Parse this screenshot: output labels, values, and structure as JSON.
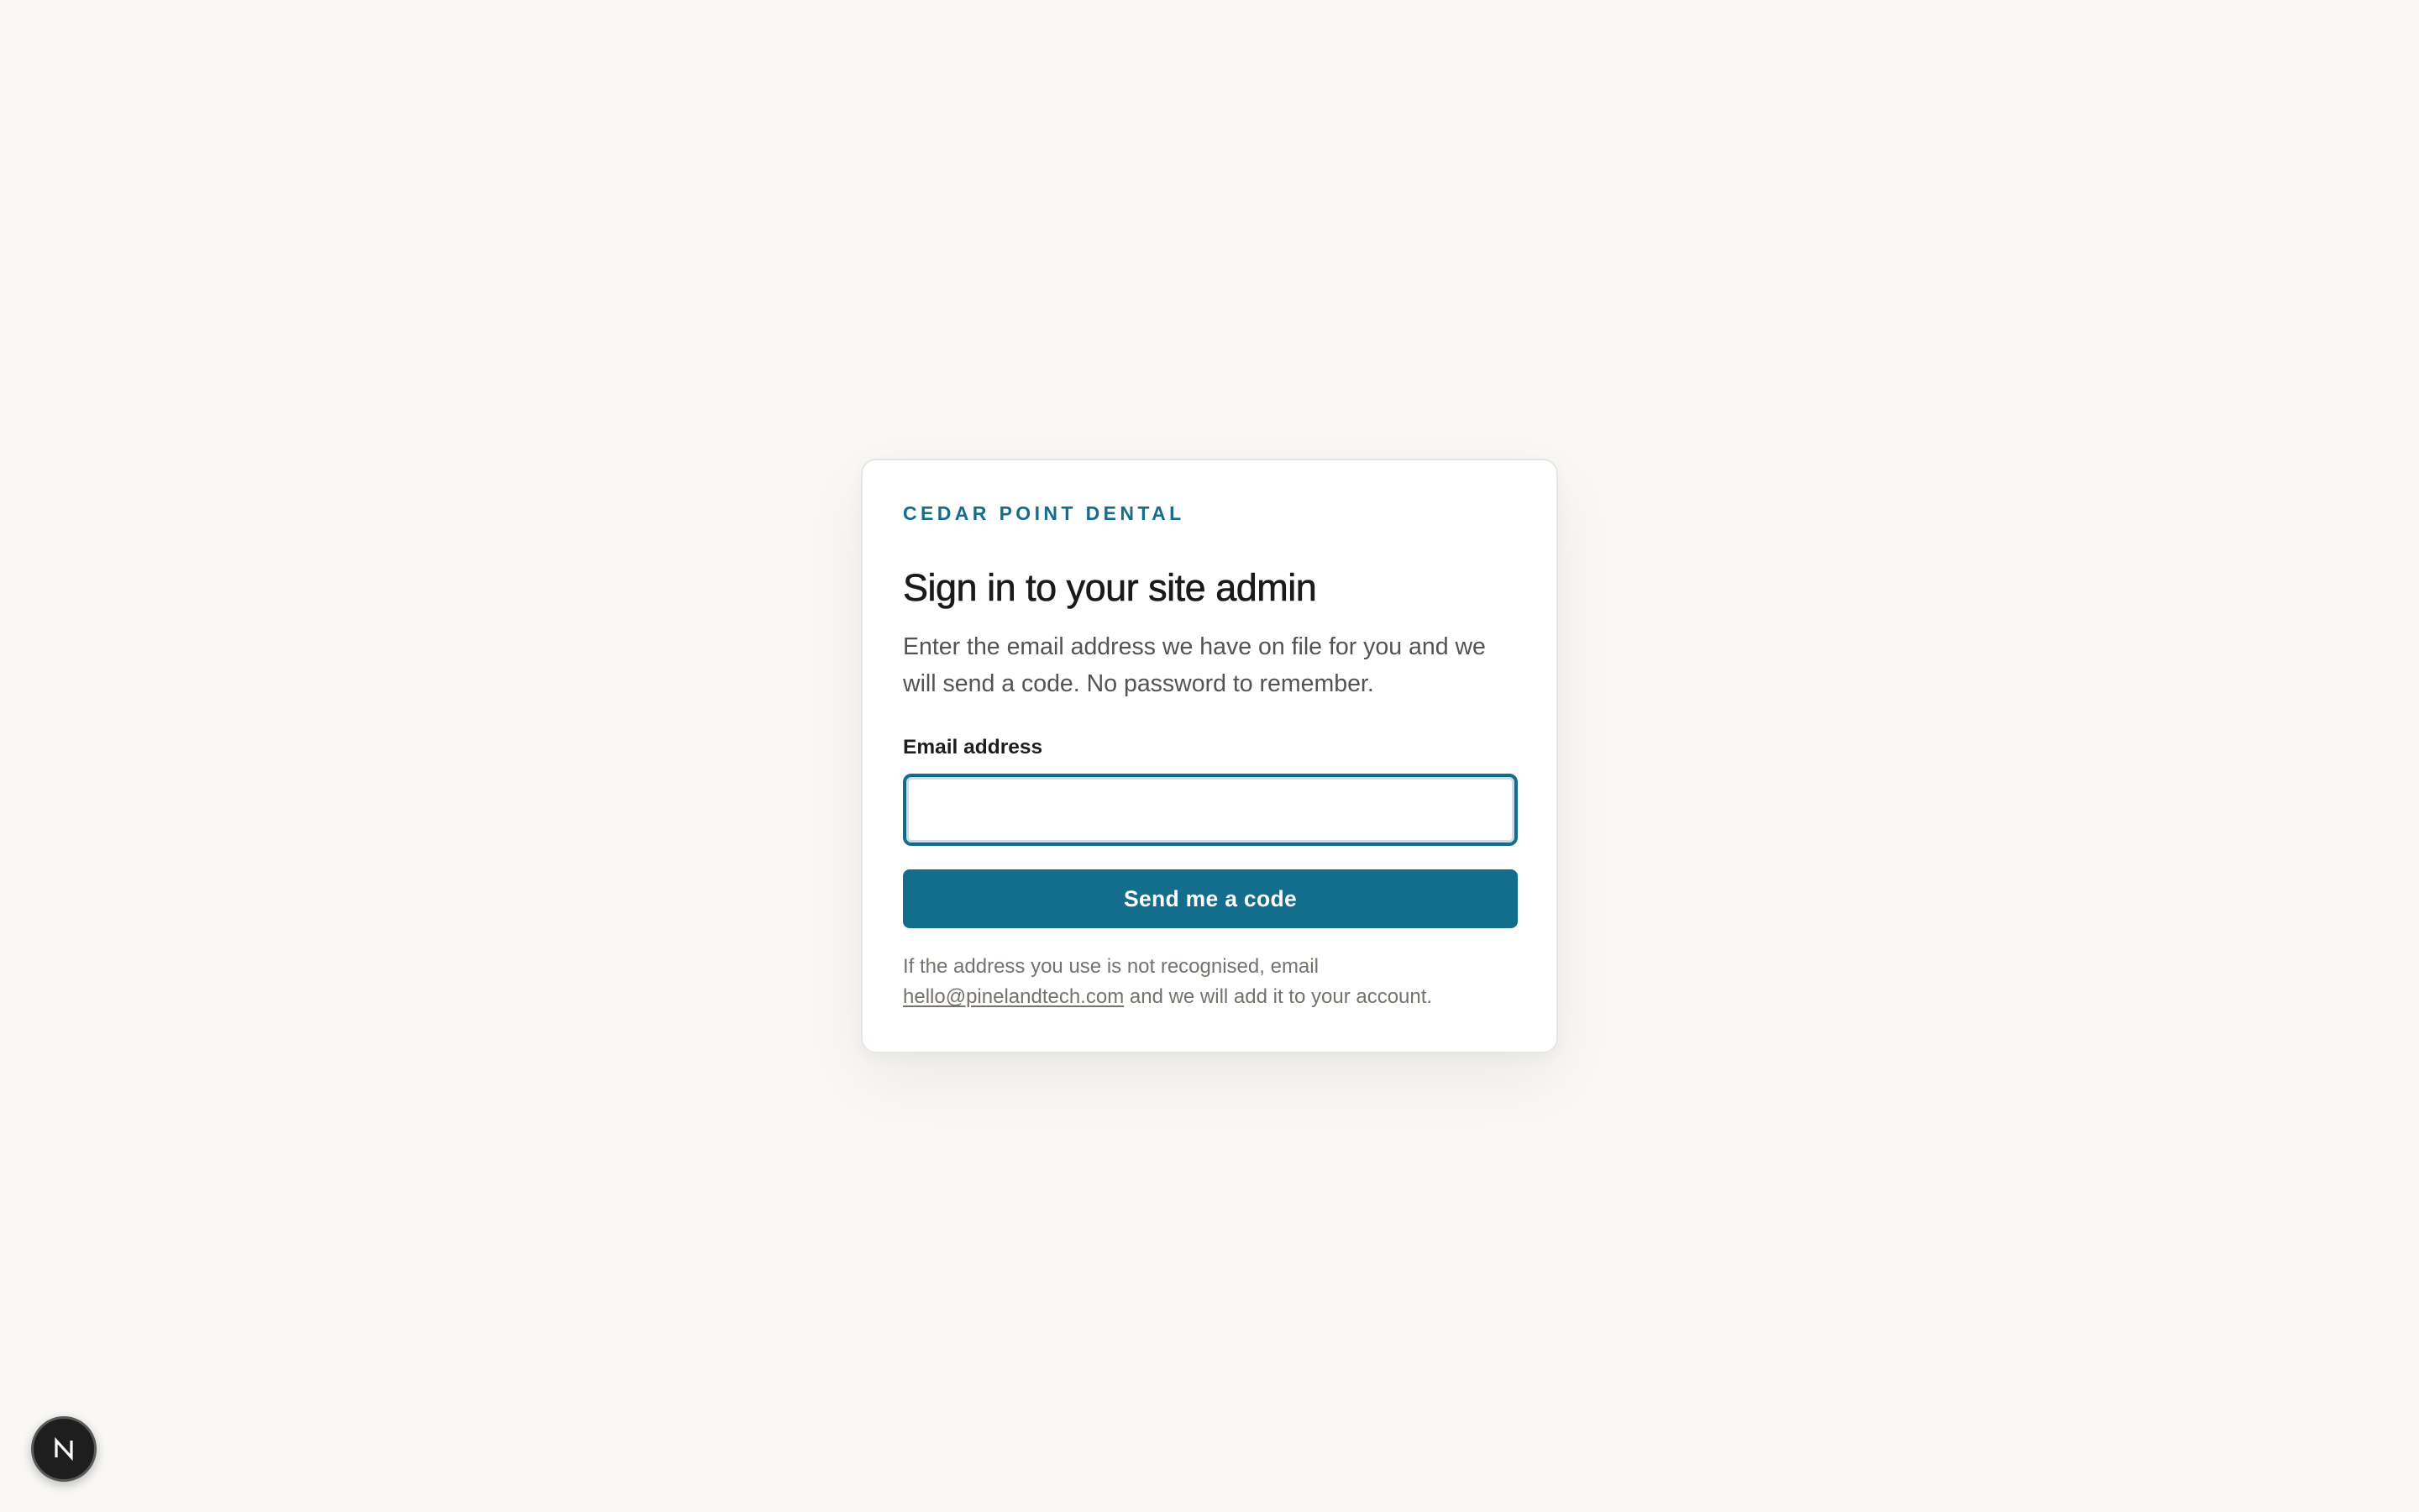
{
  "login": {
    "brand": "CEDAR POINT DENTAL",
    "title": "Sign in to your site admin",
    "subtitle": "Enter the email address we have on file for you and we will send a code. No password to remember.",
    "email_label": "Email address",
    "email_value": "",
    "email_placeholder": "",
    "submit_label": "Send me a code",
    "help_prefix": "If the address you use is not recognised, email",
    "help_email": "hello@pinelandtech.com",
    "help_suffix": "and we will add it to your account."
  },
  "dev_badge": {
    "letter": "N",
    "icon": "n-logo-icon"
  },
  "colors": {
    "background": "#f9f8f5",
    "accent": "#136d8d",
    "card": "#ffffff",
    "title": "#1a1a1a",
    "muted": "#75726c"
  }
}
